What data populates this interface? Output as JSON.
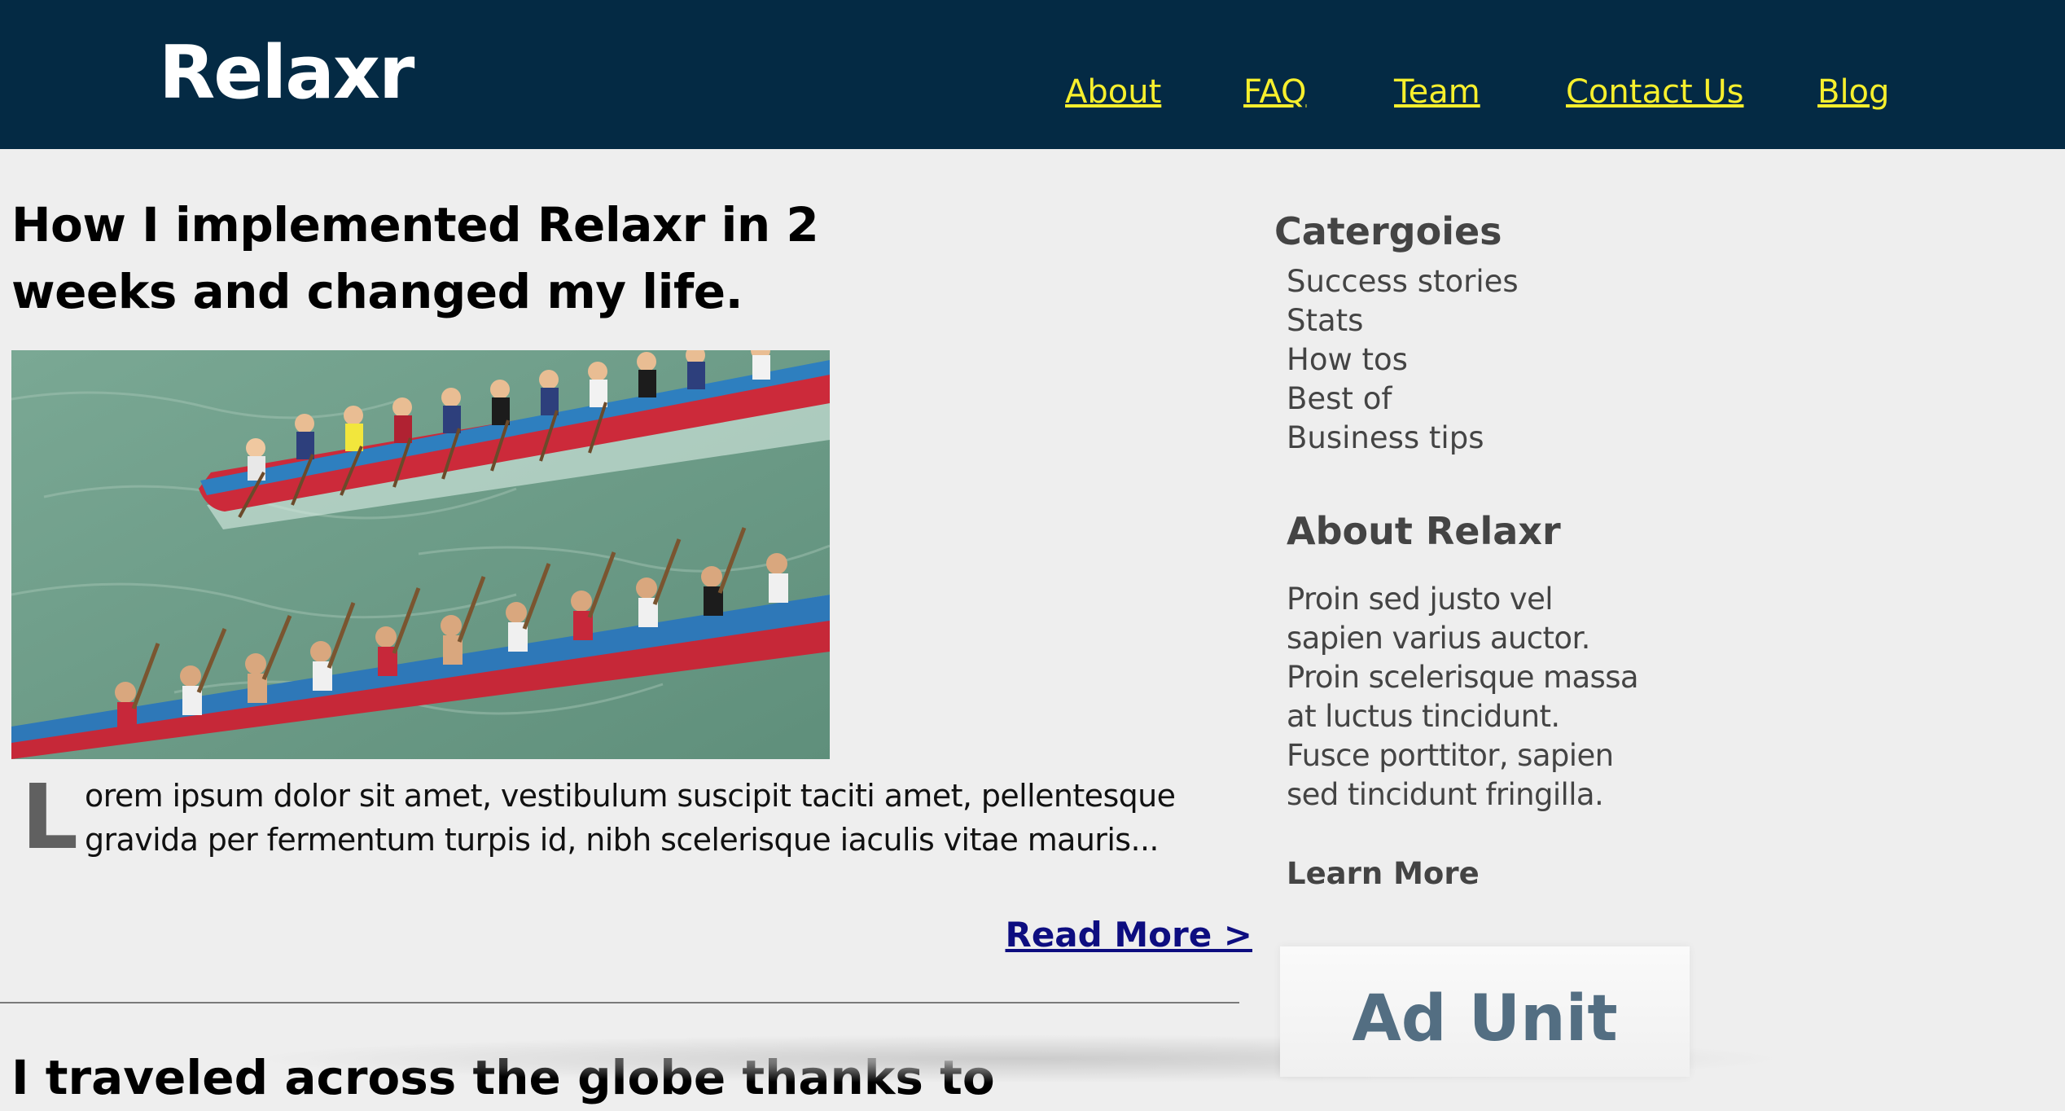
{
  "header": {
    "logo": "Relaxr",
    "nav": [
      "About",
      "FAQ",
      "Team",
      "Contact Us",
      "Blog"
    ],
    "background": "#042a44",
    "nav_color": "#f7ef2d"
  },
  "post": {
    "title": "How I implemented Relaxr in 2 weeks and changed my life.",
    "image_alt": "Dragon boat racing teams paddling on green water",
    "drop_cap": "L",
    "excerpt": "orem ipsum dolor sit amet, vestibulum suscipit taciti amet, pellentesque gravida per fermentum turpis id, nibh scelerisque iaculis vitae mauris...",
    "read_more": "Read More >"
  },
  "next_post": {
    "title": "I traveled across the globe thanks to"
  },
  "sidebar": {
    "categories_heading": "Catergoies",
    "categories": [
      "Success stories",
      "Stats",
      "How tos",
      "Best of",
      "Business tips"
    ],
    "about_heading": "About Relaxr",
    "about_text": "Proin sed justo vel sapien varius auctor. Proin scelerisque massa at luctus tincidunt. Fusce porttitor, sapien sed tincidunt fringilla.",
    "learn_more": "Learn More",
    "ad_label": "Ad Unit"
  }
}
